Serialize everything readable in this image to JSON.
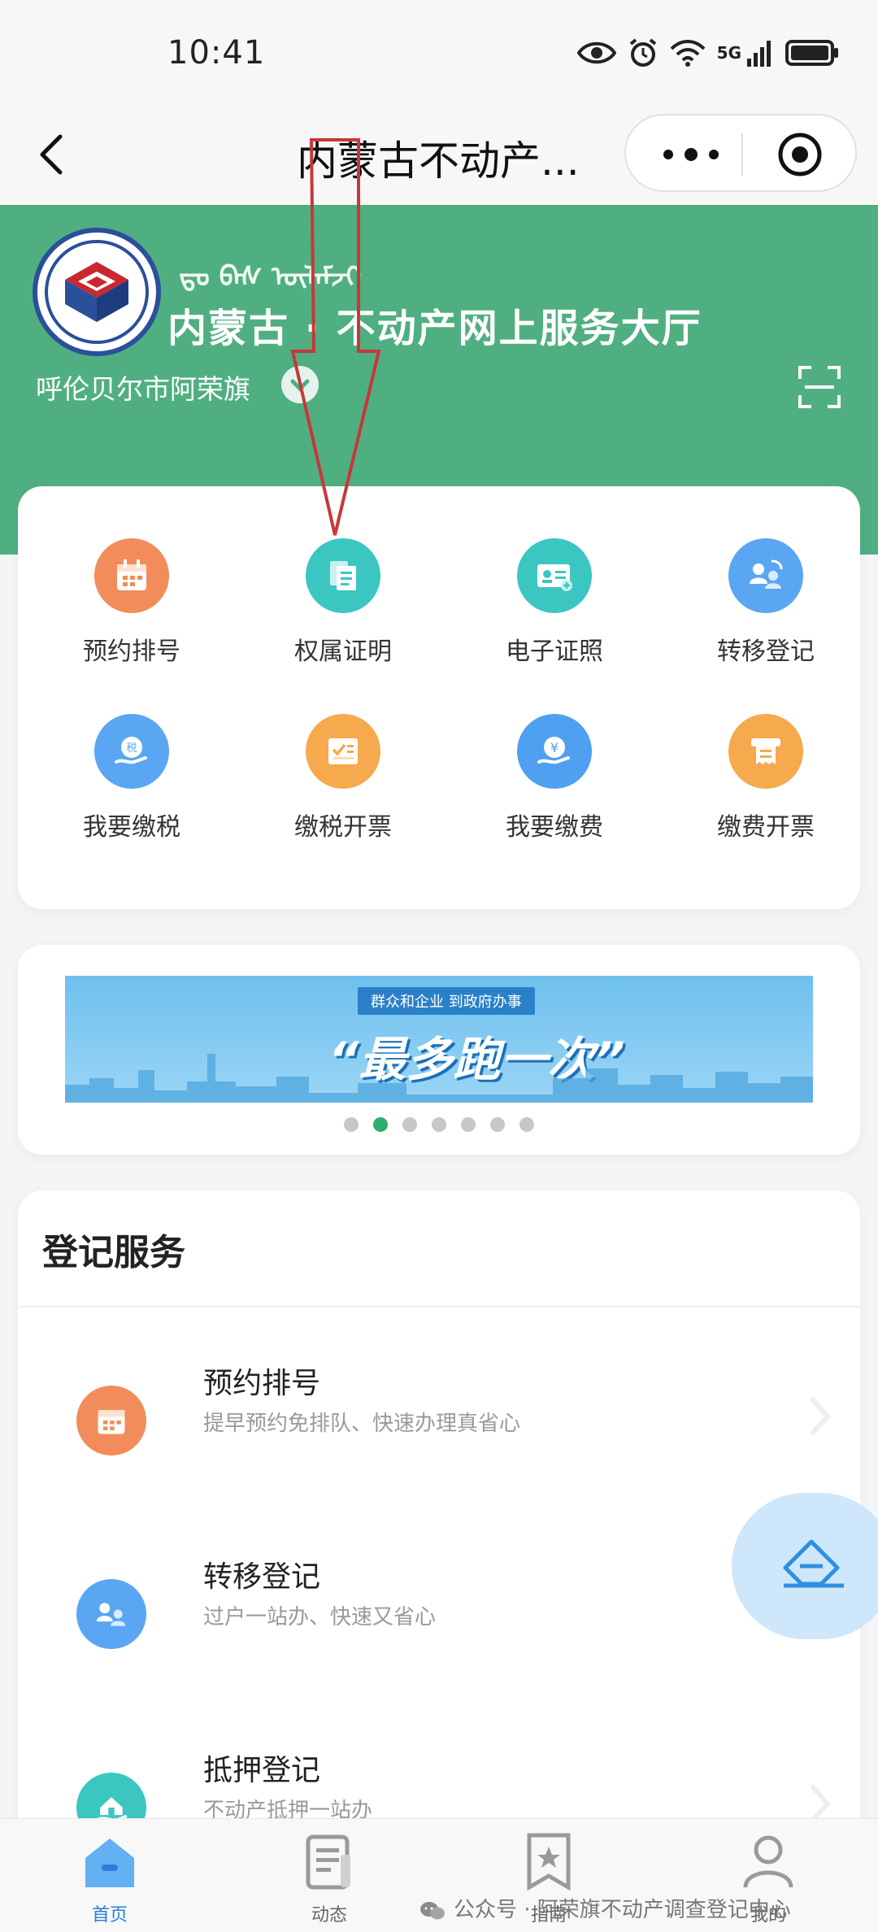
{
  "status_bar": {
    "time": "10:41",
    "network": "5G"
  },
  "nav": {
    "title": "内蒙古不动产..."
  },
  "header": {
    "mongolian_text": "ᠳᠣ ᠪᠠᠰ ᠦᠯᠡᠮᠵᠢ",
    "title": "内蒙古 · 不动产网上服务大厅",
    "city": "呼伦贝尔市阿荣旗"
  },
  "grid": [
    {
      "label": "预约排号",
      "color": "#f28c5a"
    },
    {
      "label": "权属证明",
      "color": "#3cc6c2"
    },
    {
      "label": "电子证照",
      "color": "#3cc6c2"
    },
    {
      "label": "转移登记",
      "color": "#5aa6f2"
    },
    {
      "label": "我要缴税",
      "color": "#5aa6f2"
    },
    {
      "label": "缴税开票",
      "color": "#f6a94d"
    },
    {
      "label": "我要缴费",
      "color": "#4fa0f0"
    },
    {
      "label": "缴费开票",
      "color": "#f6a94d"
    }
  ],
  "banner": {
    "tag": "群众和企业  到政府办事",
    "slogan": "“最多跑一次”",
    "dot_count": 7,
    "active_dot": 1
  },
  "services": {
    "title": "登记服务",
    "items": [
      {
        "name": "预约排号",
        "desc": "提早预约免排队、快速办理真省心",
        "color": "#f28c5a"
      },
      {
        "name": "转移登记",
        "desc": "过户一站办、快速又省心",
        "color": "#5aa6f2"
      },
      {
        "name": "抵押登记",
        "desc": "不动产抵押一站办",
        "color": "#3cc6c2"
      }
    ]
  },
  "tabs": [
    {
      "label": "首页",
      "active": true
    },
    {
      "label": "动态",
      "active": false
    },
    {
      "label": "指南",
      "active": false
    },
    {
      "label": "我的",
      "active": false
    }
  ],
  "watermark": "公众号 · 阿荣旗不动产调查登记中心",
  "colors": {
    "header_green": "#50af81",
    "annotation_red": "#c8373a",
    "active_dot": "#2fae6e"
  }
}
